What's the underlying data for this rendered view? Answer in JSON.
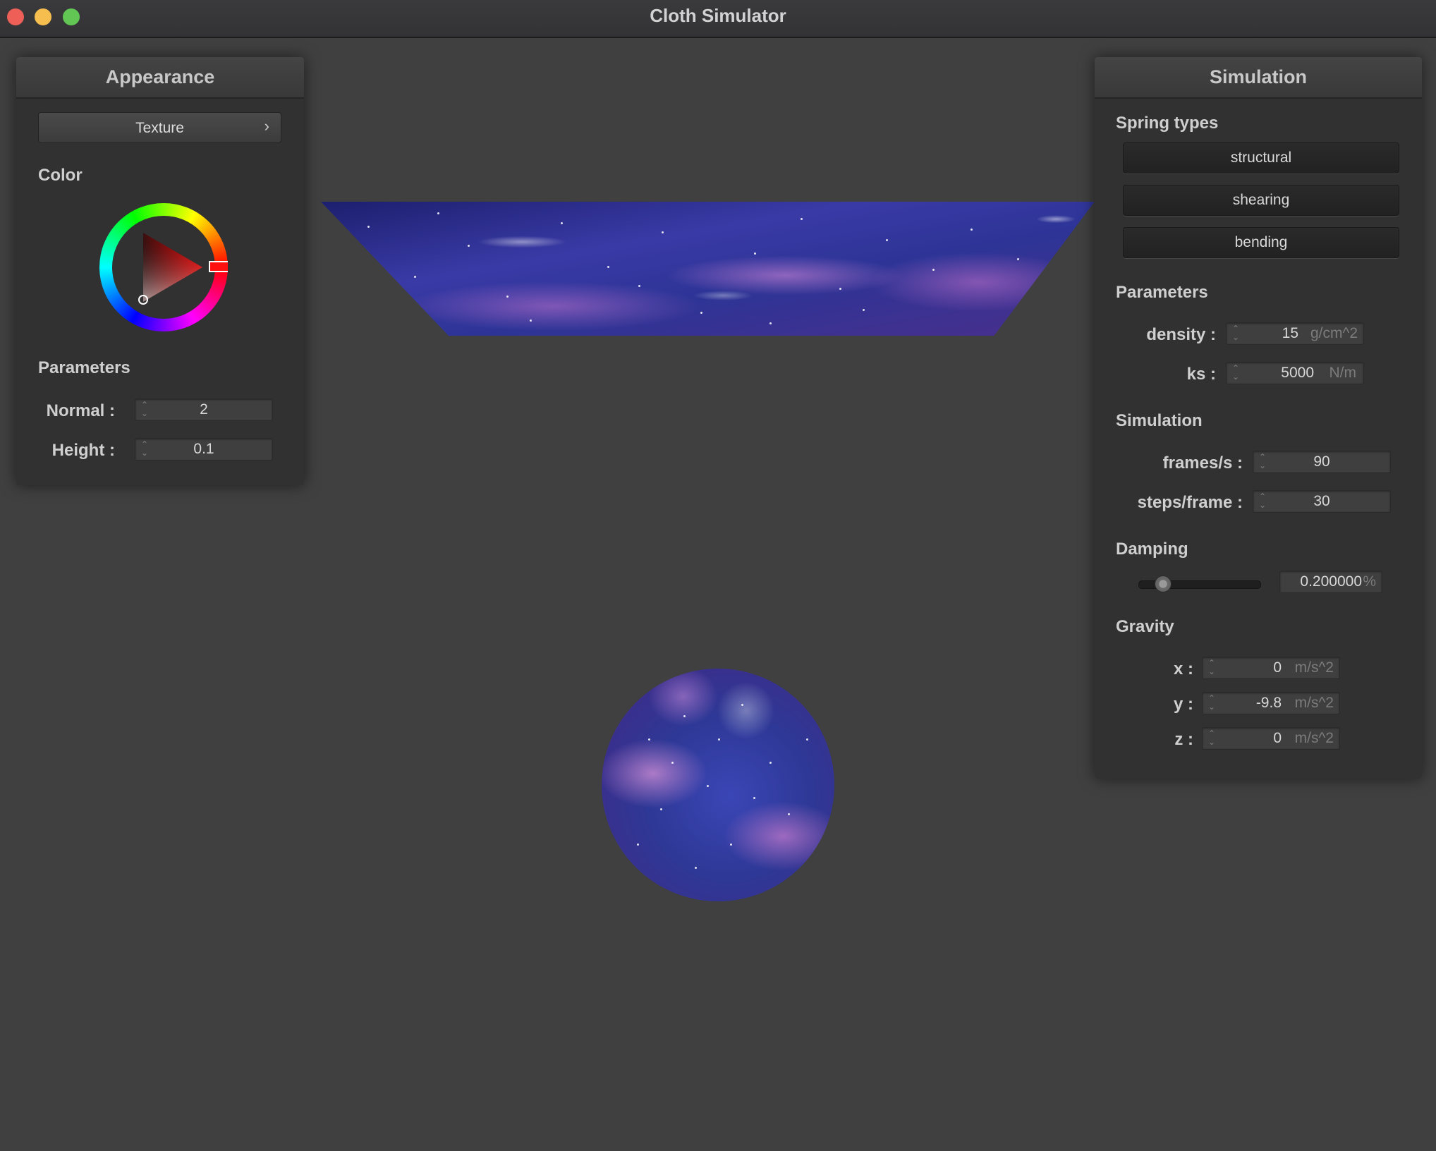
{
  "window": {
    "title": "Cloth Simulator"
  },
  "appearance": {
    "header": "Appearance",
    "texture_button": {
      "label": "Texture",
      "chevron": "›"
    },
    "color_label": "Color",
    "color": "#ff0000",
    "parameters_label": "Parameters",
    "normal": {
      "label": "Normal :",
      "value": "2"
    },
    "height": {
      "label": "Height :",
      "value": "0.1"
    }
  },
  "simulation_panel": {
    "header": "Simulation",
    "spring_types_label": "Spring types",
    "spring_types": [
      "structural",
      "shearing",
      "bending"
    ],
    "parameters_label": "Parameters",
    "density": {
      "label": "density :",
      "value": "15",
      "unit": "g/cm^2"
    },
    "ks": {
      "label": "ks :",
      "value": "5000",
      "unit": "N/m"
    },
    "simulation_label": "Simulation",
    "frames_per_s": {
      "label": "frames/s :",
      "value": "90"
    },
    "steps_per_frame": {
      "label": "steps/frame :",
      "value": "30"
    },
    "damping_label": "Damping",
    "damping": {
      "value": "0.200000",
      "unit": "%",
      "slider_fraction": 0.2
    },
    "gravity_label": "Gravity",
    "gravity": {
      "x": {
        "label": "x :",
        "value": "0",
        "unit": "m/s^2"
      },
      "y": {
        "label": "y :",
        "value": "-9.8",
        "unit": "m/s^2"
      },
      "z": {
        "label": "z :",
        "value": "0",
        "unit": "m/s^2"
      }
    }
  },
  "icons": {
    "window_controls": [
      "close-icon",
      "minimize-icon",
      "maximize-icon"
    ],
    "spinner": "spinner-icon",
    "chevron": "chevron-right-icon"
  },
  "colors": {
    "background": "#404040",
    "panel": "#313131",
    "close": "#ee5f57",
    "minimize": "#f6be4f",
    "maximize": "#62c655"
  }
}
